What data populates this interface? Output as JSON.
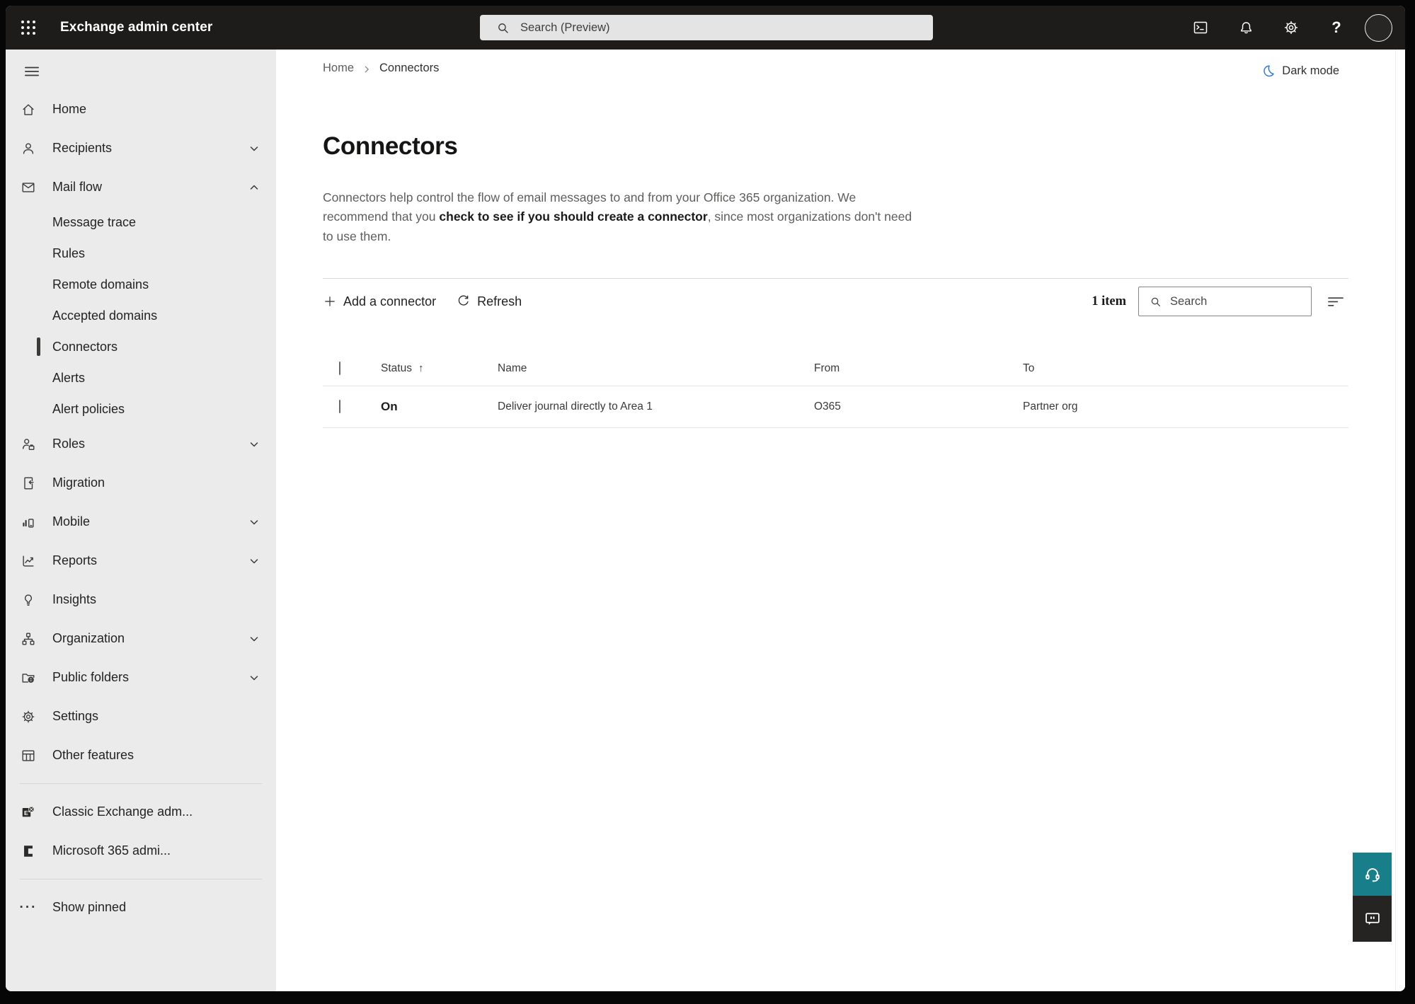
{
  "app": {
    "title": "Exchange admin center"
  },
  "topbar": {
    "search_placeholder": "Search (Preview)"
  },
  "sidebar": {
    "selected": "Connectors",
    "items": [
      {
        "label": "Home"
      },
      {
        "label": "Recipients"
      },
      {
        "label": "Mail flow"
      },
      {
        "label": "Message trace"
      },
      {
        "label": "Rules"
      },
      {
        "label": "Remote domains"
      },
      {
        "label": "Accepted domains"
      },
      {
        "label": "Connectors"
      },
      {
        "label": "Alerts"
      },
      {
        "label": "Alert policies"
      },
      {
        "label": "Roles"
      },
      {
        "label": "Migration"
      },
      {
        "label": "Mobile"
      },
      {
        "label": "Reports"
      },
      {
        "label": "Insights"
      },
      {
        "label": "Organization"
      },
      {
        "label": "Public folders"
      },
      {
        "label": "Settings"
      },
      {
        "label": "Other features"
      },
      {
        "label": "Classic Exchange adm..."
      },
      {
        "label": "Microsoft 365 admi..."
      },
      {
        "label": "Show pinned"
      }
    ]
  },
  "breadcrumb": {
    "home": "Home",
    "current": "Connectors"
  },
  "header": {
    "dark_mode_label": "Dark mode"
  },
  "page": {
    "title": "Connectors",
    "desc_pre": "Connectors help control the flow of email messages to and from your Office 365 organization. We recommend that you ",
    "desc_link": "check to see if you should create a connector",
    "desc_post": ", since most organizations don't need to use them."
  },
  "toolbar": {
    "add_label": "Add a connector",
    "refresh_label": "Refresh",
    "item_count": "1 item",
    "search_placeholder": "Search"
  },
  "table": {
    "columns": {
      "status": "Status",
      "name": "Name",
      "from": "From",
      "to": "To"
    },
    "sort_icon": "↑",
    "rows": [
      {
        "status": "On",
        "name": "Deliver journal directly to Area 1",
        "from": "O365",
        "to": "Partner org"
      }
    ]
  },
  "glyphs": {
    "help": "?",
    "more": "···"
  },
  "colors": {
    "topbar": "#1d1c1b",
    "sidebar_bg": "#ebebeb",
    "accent_teal": "#177e8a",
    "feedback_dark": "#252423",
    "moon_blue": "#3179d6",
    "selected_marker": "#3b3a39"
  }
}
